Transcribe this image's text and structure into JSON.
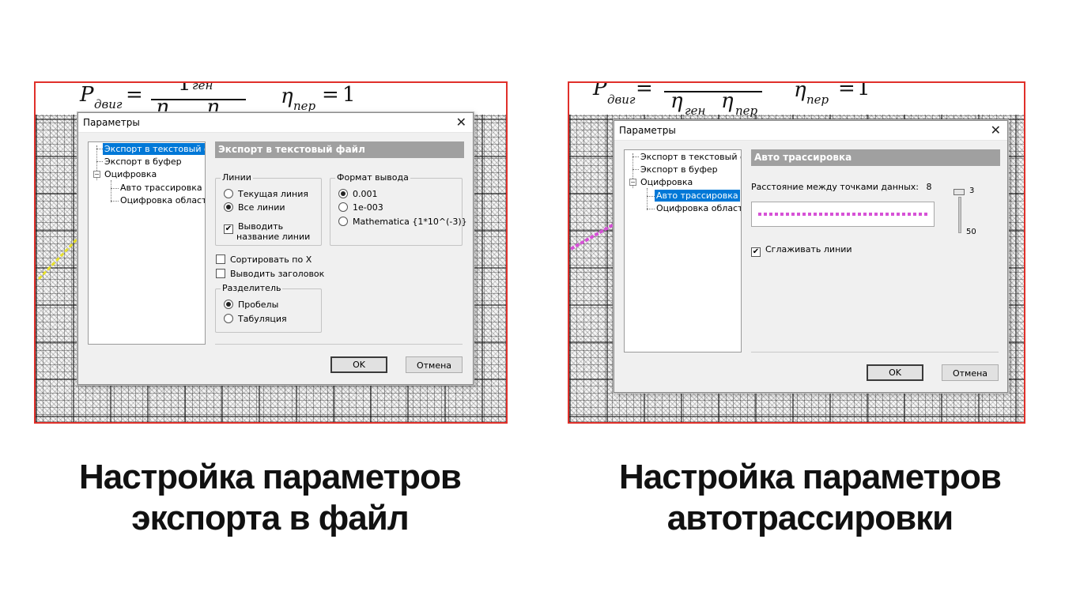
{
  "left_panel": {
    "dialog": {
      "title": "Параметры",
      "close_glyph": "✕",
      "tree": {
        "items": [
          {
            "label": "Экспорт в текстовый фа",
            "selected": true
          },
          {
            "label": "Экспорт в буфер",
            "selected": false
          },
          {
            "label": "Оцифровка",
            "selected": false
          },
          {
            "label": "Авто трассировка",
            "selected": false
          },
          {
            "label": "Оцифровка области",
            "selected": false
          }
        ]
      },
      "section_title": "Экспорт в текстовый файл",
      "lines_group": {
        "legend": "Линии",
        "options": [
          {
            "label": "Текущая линия",
            "checked": false
          },
          {
            "label": "Все линии",
            "checked": true
          }
        ],
        "checkbox_line1": "Выводить",
        "checkbox_line2": "название линии",
        "checkbox_checked": true
      },
      "format_group": {
        "legend": "Формат вывода",
        "options": [
          {
            "label": "0.001",
            "checked": true
          },
          {
            "label": "1e-003",
            "checked": false
          },
          {
            "label": "Mathematica {1*10^(-3)}",
            "checked": false
          }
        ]
      },
      "sort_x": "Сортировать по X",
      "print_header": "Выводить заголовок",
      "separator_group": {
        "legend": "Разделитель",
        "options": [
          {
            "label": "Пробелы",
            "checked": true
          },
          {
            "label": "Табуляция",
            "checked": false
          }
        ]
      },
      "ok": "OK",
      "cancel": "Отмена"
    },
    "caption_line1": "Настройка параметров",
    "caption_line2": "экспорта в файл"
  },
  "right_panel": {
    "dialog": {
      "title": "Параметры",
      "close_glyph": "✕",
      "tree": {
        "items": [
          {
            "label": "Экспорт в текстовый фа",
            "selected": false
          },
          {
            "label": "Экспорт в буфер",
            "selected": false
          },
          {
            "label": "Оцифровка",
            "selected": false
          },
          {
            "label": "Авто трассировка",
            "selected": true
          },
          {
            "label": "Оцифровка области",
            "selected": false
          }
        ]
      },
      "section_title": "Авто трассировка",
      "distance_label": "Расстояние между точками данных:",
      "distance_value": "8",
      "slider_max_label": "3",
      "slider_min_label": "50",
      "smooth_label": "Сглаживать линии",
      "smooth_checked": true,
      "ok": "OK",
      "cancel": "Отмена"
    },
    "caption_line1": "Настройка параметров",
    "caption_line2": "автотрассировки"
  },
  "formula_left": {
    "p": "P",
    "p_sub": "двиг",
    "eq": "=",
    "num": "1",
    "num_sub": "ген",
    "eta1": "η",
    "eta2": "η",
    "eta3": "η",
    "eta3_sub": "пер",
    "eq2": "=",
    "one": "1"
  },
  "formula_right": {
    "p": "P",
    "p_sub": "двиг",
    "eq": "=",
    "eta1": "η",
    "eta1_sub": "ген",
    "eta2": "η",
    "eta2_sub": "пер",
    "eta3": "η",
    "eta3_sub": "пер",
    "eq2": "=",
    "one": "1"
  },
  "colors": {
    "frame": "#e0302a",
    "selection": "#0078d7",
    "header_bar": "#a0a0a0",
    "dotted_line": "#d652d6",
    "trace_left": "#e8e02a"
  }
}
